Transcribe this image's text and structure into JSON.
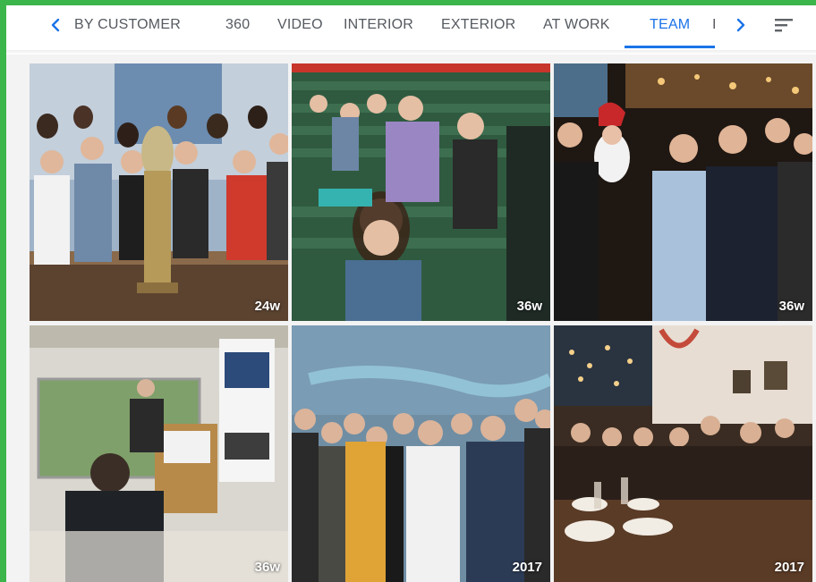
{
  "tabs": {
    "items": [
      {
        "label": "BY CUSTOMER"
      },
      {
        "label": "360"
      },
      {
        "label": "VIDEO"
      },
      {
        "label": "INTERIOR"
      },
      {
        "label": "EXTERIOR"
      },
      {
        "label": "AT WORK"
      },
      {
        "label": "TEAM"
      },
      {
        "label": "I"
      }
    ],
    "active": "TEAM",
    "prev_icon": "chevron-left-icon",
    "next_icon": "chevron-right-icon",
    "sort_icon": "sort-filter-icon"
  },
  "photos": [
    {
      "age": "24w"
    },
    {
      "age": "36w"
    },
    {
      "age": "36w"
    },
    {
      "age": "36w"
    },
    {
      "age": "2017"
    },
    {
      "age": "2017"
    }
  ],
  "colors": {
    "accent": "#1a73e8",
    "border": "#3cb54a",
    "tab_text": "#555a60"
  }
}
